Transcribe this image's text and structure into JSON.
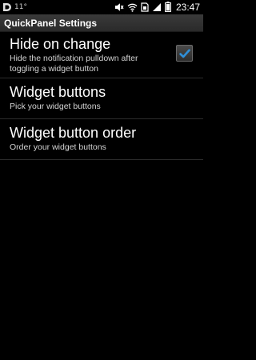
{
  "status_bar": {
    "temperature": "11°",
    "time": "23:47",
    "icons": [
      "notification-d-icon",
      "mute-icon",
      "wifi-icon",
      "sim-card-icon",
      "signal-icon",
      "battery-icon"
    ]
  },
  "header": {
    "title": "QuickPanel Settings"
  },
  "preferences": [
    {
      "title": "Hide on change",
      "summary": "Hide the notification pulldown after toggling a widget button",
      "checked": true
    },
    {
      "title": "Widget buttons",
      "summary": "Pick your widget buttons"
    },
    {
      "title": "Widget button order",
      "summary": "Order your widget buttons"
    }
  ],
  "colors": {
    "background": "#000000",
    "checkmark": "#2f8fd8",
    "divider": "#2b2b2b"
  }
}
